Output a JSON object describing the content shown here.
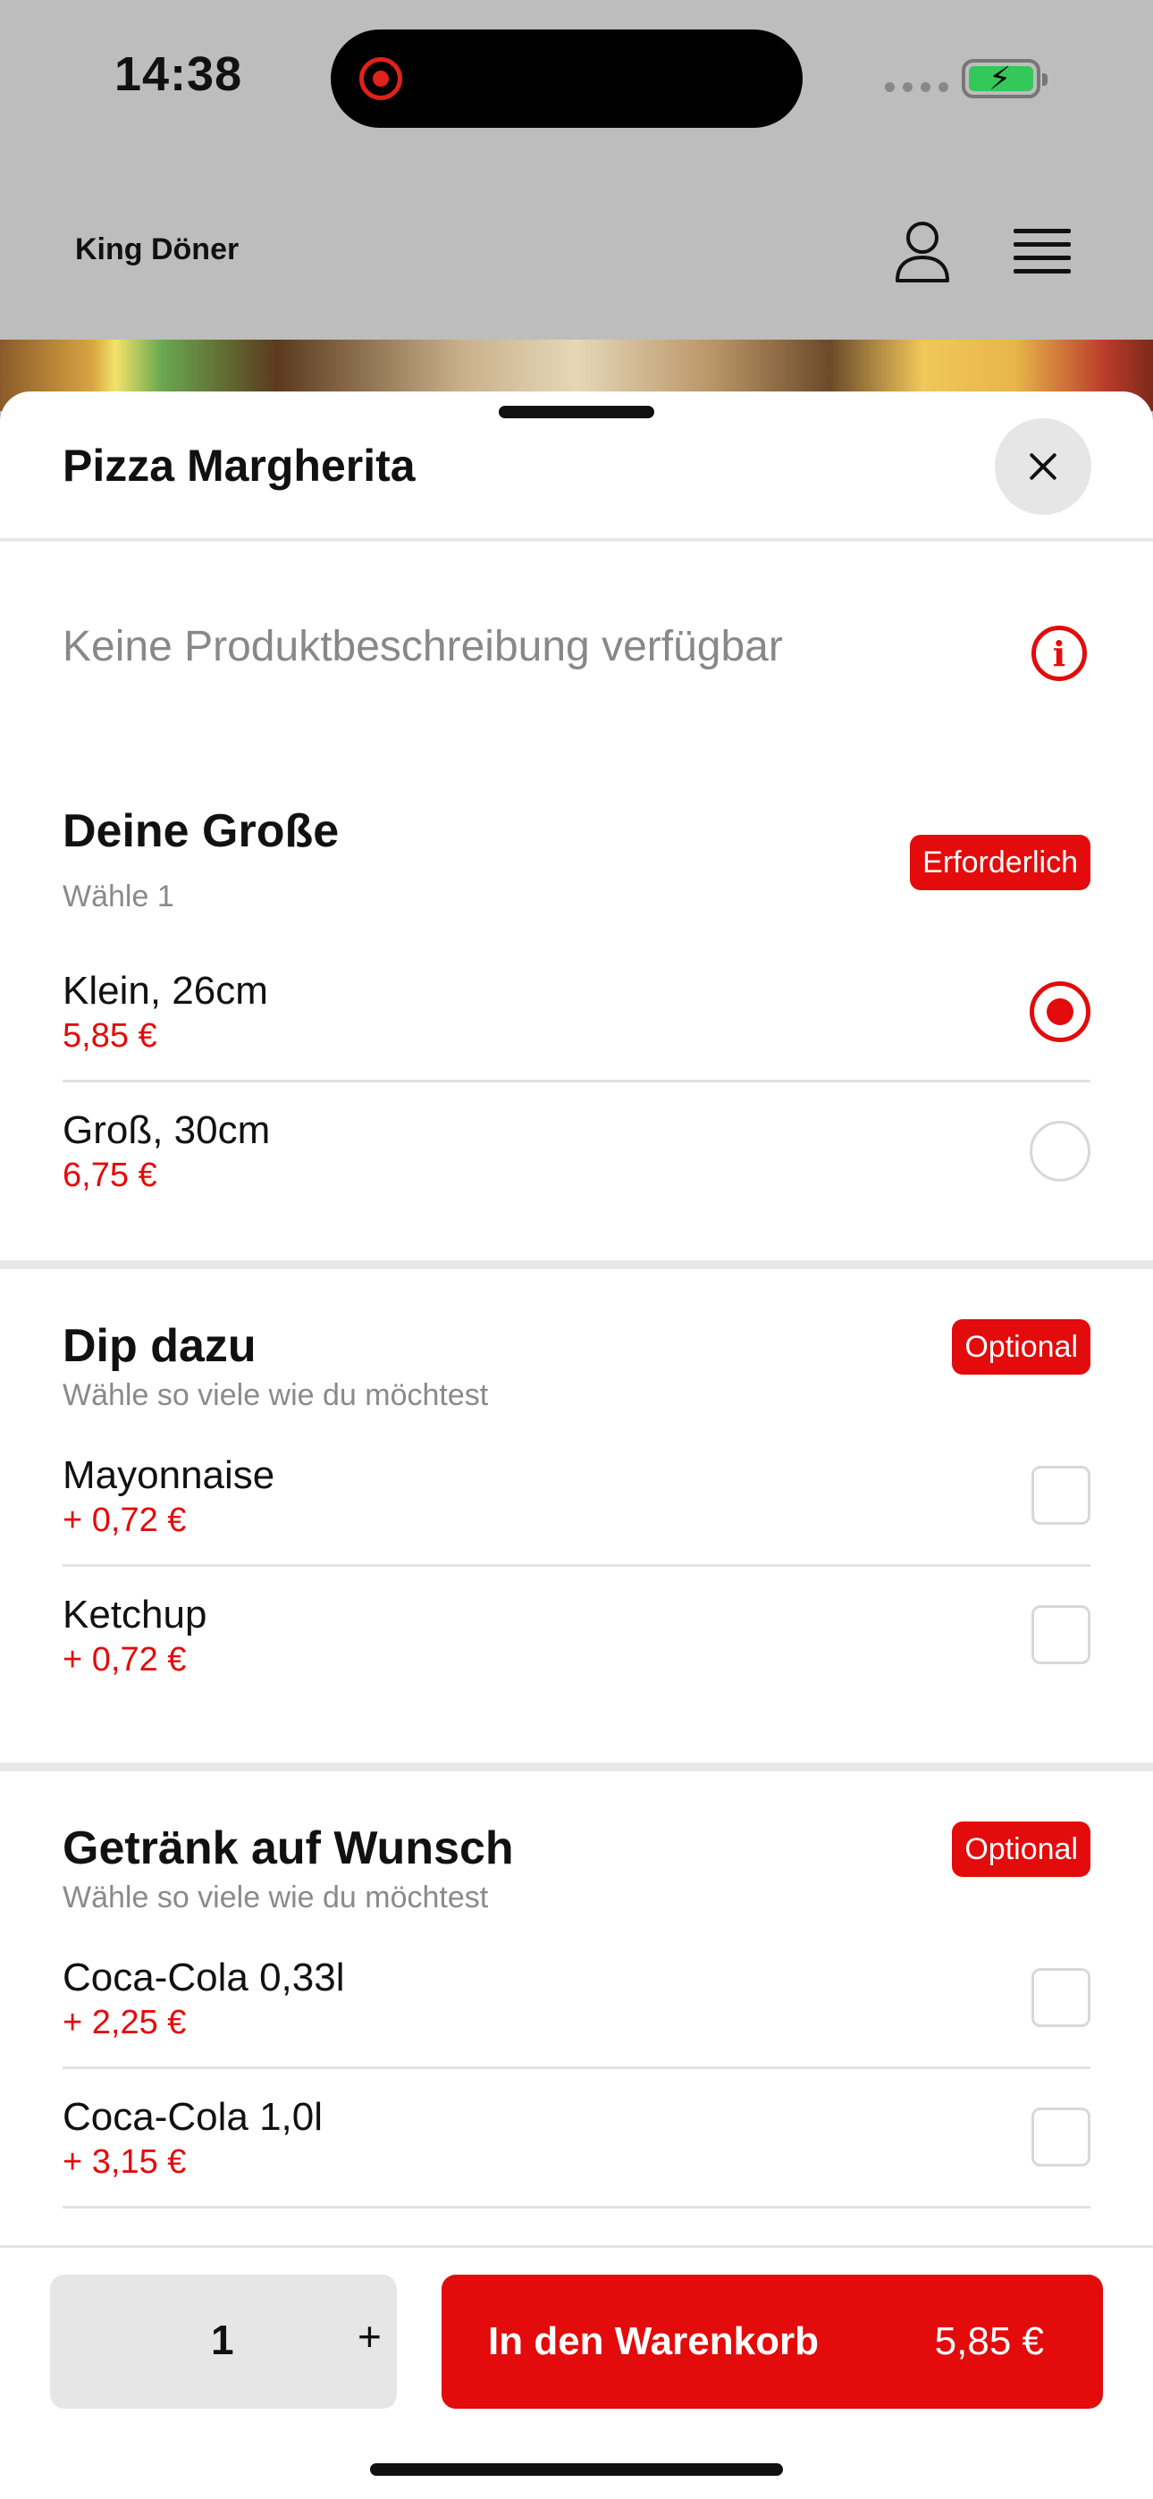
{
  "status_bar": {
    "time": "14:38"
  },
  "header": {
    "brand": "King Döner"
  },
  "product": {
    "title": "Pizza Margherita",
    "description": "Keine Produktbeschreibung verfügbar"
  },
  "groups": [
    {
      "title": "Deine Große",
      "subtitle": "Wähle 1",
      "badge": "Erforderlich",
      "type": "radio",
      "options": [
        {
          "name": "Klein, 26cm",
          "price": "5,85 €",
          "selected": true
        },
        {
          "name": "Groß, 30cm",
          "price": "6,75 €",
          "selected": false
        }
      ]
    },
    {
      "title": "Dip dazu",
      "subtitle": "Wähle so viele wie du möchtest",
      "badge": "Optional",
      "type": "checkbox",
      "options": [
        {
          "name": "Mayonnaise",
          "price": "+ 0,72 €",
          "selected": false
        },
        {
          "name": "Ketchup",
          "price": "+ 0,72 €",
          "selected": false
        }
      ]
    },
    {
      "title": "Getränk auf Wunsch",
      "subtitle": "Wähle so viele wie du möchtest",
      "badge": "Optional",
      "type": "checkbox",
      "options": [
        {
          "name": "Coca-Cola 0,33l",
          "price": "+ 2,25 €",
          "selected": false
        },
        {
          "name": "Coca-Cola 1,0l",
          "price": "+ 3,15 €",
          "selected": false
        }
      ]
    }
  ],
  "cart": {
    "quantity": "1",
    "plus": "+",
    "button_label": "In den Warenkorb",
    "total": "5,85 €"
  },
  "colors": {
    "accent": "#e30b0b",
    "overlay": "#bdbdbd"
  },
  "icons": [
    "user-icon",
    "menu-icon",
    "close-icon",
    "info-icon"
  ]
}
